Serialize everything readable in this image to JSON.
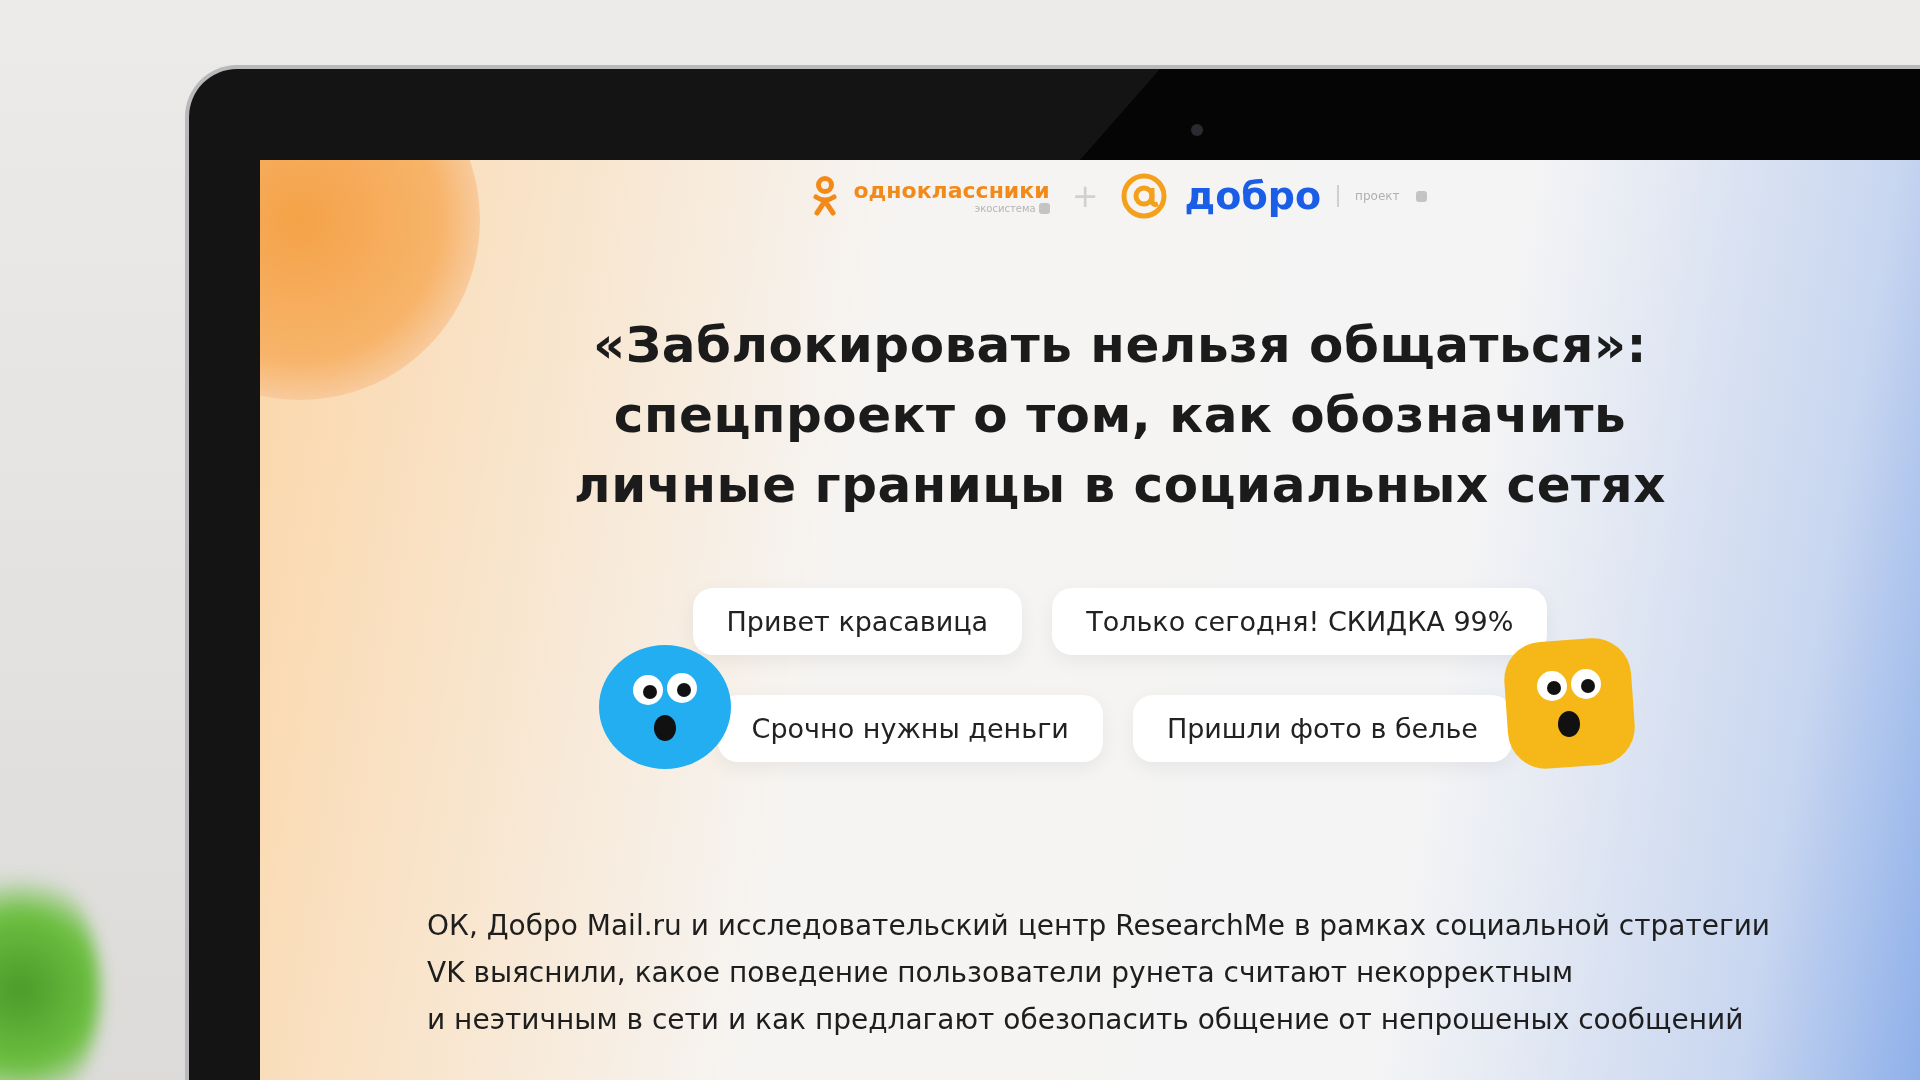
{
  "header": {
    "brand_1": "одноклассники",
    "brand_1_sub": "экосистема",
    "plus": "+",
    "brand_2": "добро",
    "brand_2_sub": "проект"
  },
  "title": [
    "«Заблокировать нельзя общаться»:",
    "спецпроект о том, как обозначить",
    "личные границы в социальных сетях"
  ],
  "chip_rows": [
    [
      "Привет красавица",
      "Только сегодня! СКИДКА 99%"
    ],
    [
      "Срочно нужны деньги",
      "Пришли фото в белье"
    ]
  ],
  "description": [
    "ОК, Добро Mail.ru и исследовательский центр ResearchMe в рамках социальной стратегии",
    "VK выяснили, какое поведение пользователи рунета считают некорректным",
    "и неэтичным в сети и как предлагают обезопасить общение от непрошеных сообщений"
  ]
}
